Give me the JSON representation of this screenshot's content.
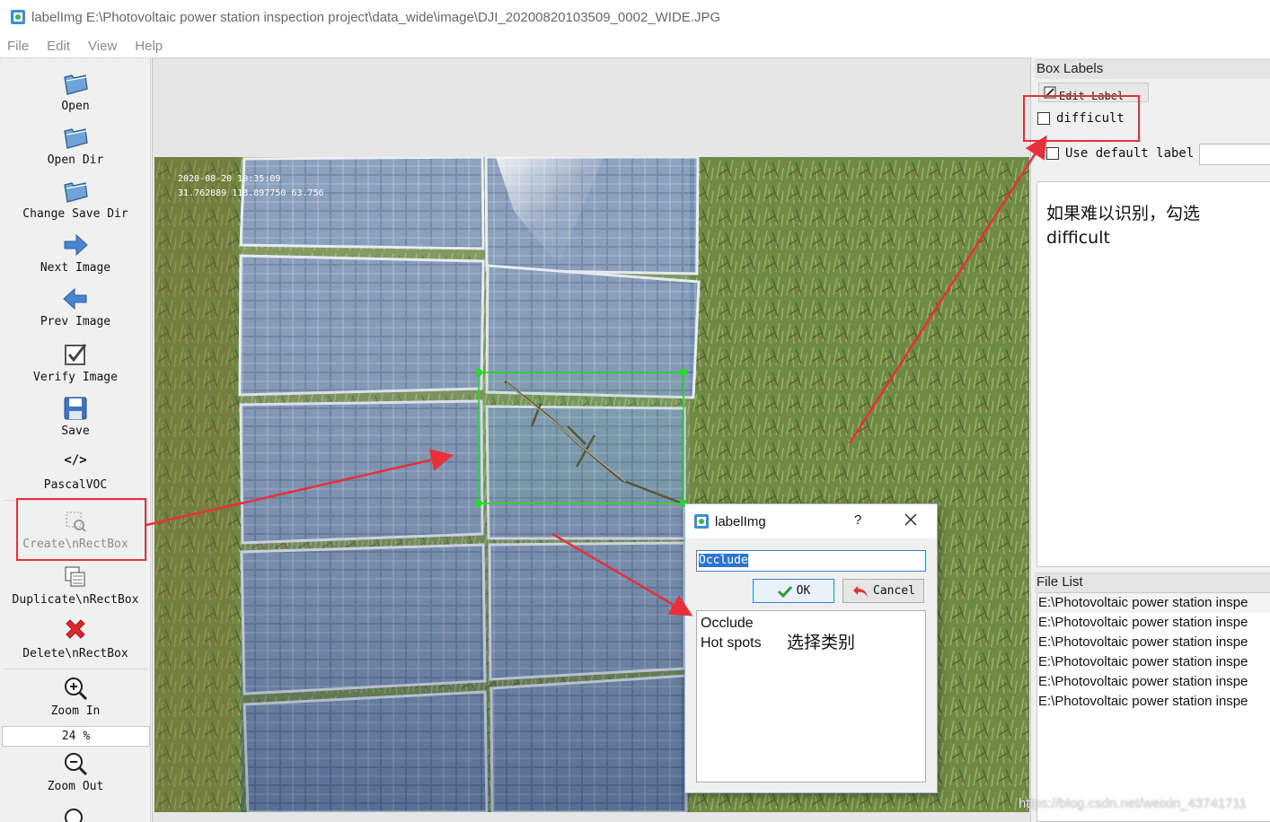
{
  "window": {
    "title": "labelImg E:\\Photovoltaic power station inspection project\\data_wide\\image\\DJI_20200820103509_0002_WIDE.JPG"
  },
  "menu": [
    "File",
    "Edit",
    "View",
    "Help"
  ],
  "toolbar": {
    "open": "Open",
    "open_dir": "Open Dir",
    "change_save_dir": "Change Save Dir",
    "next_image": "Next Image",
    "prev_image": "Prev Image",
    "verify_image": "Verify Image",
    "save": "Save",
    "format": "PascalVOC",
    "create_rectbox": "Create\\nRectBox",
    "duplicate_rectbox": "Duplicate\\nRectBox",
    "delete_rectbox": "Delete\\nRectBox",
    "zoom_in": "Zoom In",
    "zoom_value": "24 %",
    "zoom_out": "Zoom Out"
  },
  "photo_overlay": {
    "timestamp": "2020-08-20 10:35:09",
    "coordinates": "31.762889 118.897750 63.756"
  },
  "box_labels": {
    "title": "Box Labels",
    "edit_label": "Edit Label",
    "difficult": "difficult",
    "use_default_label": "Use default label",
    "default_label_value": "",
    "difficult_checked": false,
    "use_default_checked": false
  },
  "annotation_note": "如果难以识别，勾选difficult",
  "file_list": {
    "title": "File List",
    "items": [
      "E:\\Photovoltaic power station inspe",
      "E:\\Photovoltaic power station inspe",
      "E:\\Photovoltaic power station inspe",
      "E:\\Photovoltaic power station inspe",
      "E:\\Photovoltaic power station inspe",
      "E:\\Photovoltaic power station inspe"
    ]
  },
  "dialog": {
    "title": "labelImg",
    "help": "?",
    "input_value": "Occlude",
    "ok": "OK",
    "cancel": "Cancel",
    "options": [
      "Occlude",
      "Hot spots"
    ],
    "note": "选择类别"
  },
  "watermark": "https://blog.csdn.net/weixin_43741711",
  "colors": {
    "highlight_red": "#e8303a",
    "bbox_green": "#22dd22",
    "selection_blue": "#2d73d1"
  }
}
